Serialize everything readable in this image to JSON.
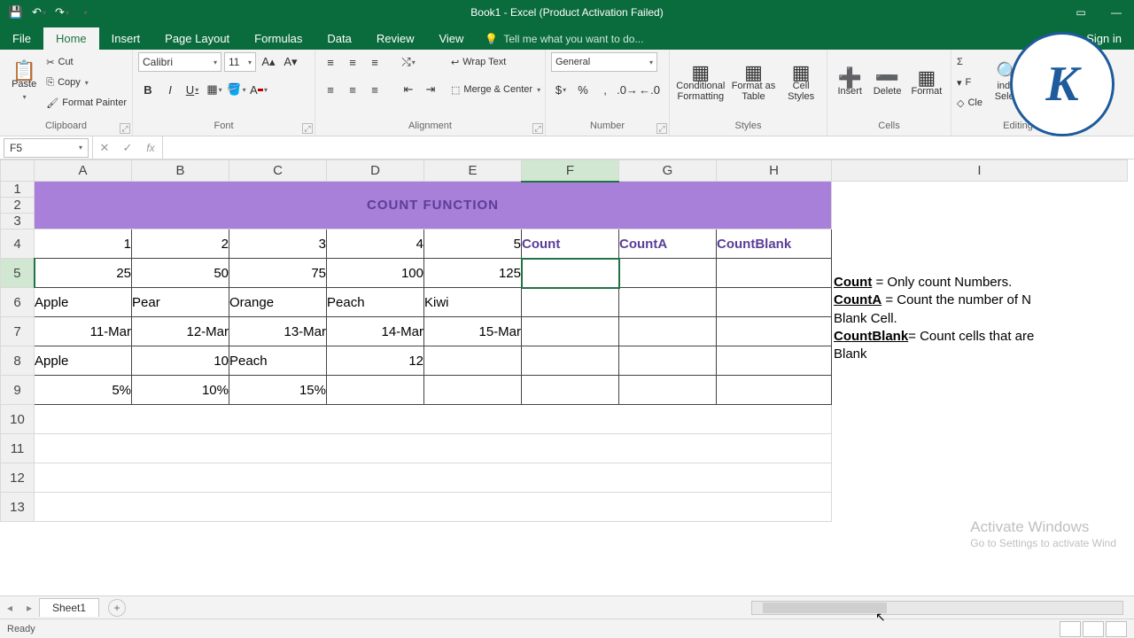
{
  "title": "Book1 - Excel (Product Activation Failed)",
  "signin": "Sign in",
  "tabs": {
    "file": "File",
    "home": "Home",
    "insert": "Insert",
    "pagelayout": "Page Layout",
    "formulas": "Formulas",
    "data": "Data",
    "review": "Review",
    "view": "View",
    "tellme": "Tell me what you want to do..."
  },
  "ribbon": {
    "clipboard": {
      "paste": "Paste",
      "cut": "Cut",
      "copy": "Copy",
      "painter": "Format Painter",
      "label": "Clipboard"
    },
    "font": {
      "name": "Calibri",
      "size": "11",
      "label": "Font"
    },
    "alignment": {
      "wrap": "Wrap Text",
      "merge": "Merge & Center",
      "label": "Alignment"
    },
    "number": {
      "format": "General",
      "label": "Number"
    },
    "styles": {
      "cond": "Conditional Formatting",
      "fmt": "Format as Table",
      "cell": "Cell Styles",
      "label": "Styles"
    },
    "cells": {
      "insert": "Insert",
      "delete": "Delete",
      "format": "Format",
      "label": "Cells"
    },
    "editing": {
      "fill": "F",
      "clear": "Cle",
      "find": "ind & Select",
      "label": "Editing"
    }
  },
  "namebox": "F5",
  "columns": [
    "A",
    "B",
    "C",
    "D",
    "E",
    "F",
    "G",
    "H",
    "I"
  ],
  "rows": [
    "1",
    "2",
    "3",
    "4",
    "5",
    "6",
    "7",
    "8",
    "9",
    "10",
    "11",
    "12",
    "13"
  ],
  "selected_col": "F",
  "selected_row": "5",
  "title_cell": "COUNT FUNCTION",
  "row4": {
    "A": "1",
    "B": "2",
    "C": "3",
    "D": "4",
    "E": "5",
    "F": "Count",
    "G": "CountA",
    "H": "CountBlank"
  },
  "row5": {
    "A": "25",
    "B": "50",
    "C": "75",
    "D": "100",
    "E": "125"
  },
  "row6": {
    "A": "Apple",
    "B": "Pear",
    "C": "Orange",
    "D": "Peach",
    "E": "Kiwi"
  },
  "row7": {
    "A": "11-Mar",
    "B": "12-Mar",
    "C": "13-Mar",
    "D": "14-Mar",
    "E": "15-Mar"
  },
  "row8": {
    "A": "Apple",
    "B": "10",
    "C": "Peach",
    "D": "12"
  },
  "row9": {
    "A": "5%",
    "B": "10%",
    "C": "15%"
  },
  "notes": {
    "count_t": "Count",
    "count_d": " = Only count Numbers.",
    "counta_t": "CountA",
    "counta_d": " = Count the number of N",
    "counta_d2": "Blank Cell.",
    "countblank_t": "CountBlank",
    "countblank_d": "= Count cells that are",
    "countblank_d2": "Blank"
  },
  "sheet_tab": "Sheet1",
  "status": "Ready",
  "watermark": {
    "l1": "Activate Windows",
    "l2": "Go to Settings to activate Wind"
  }
}
